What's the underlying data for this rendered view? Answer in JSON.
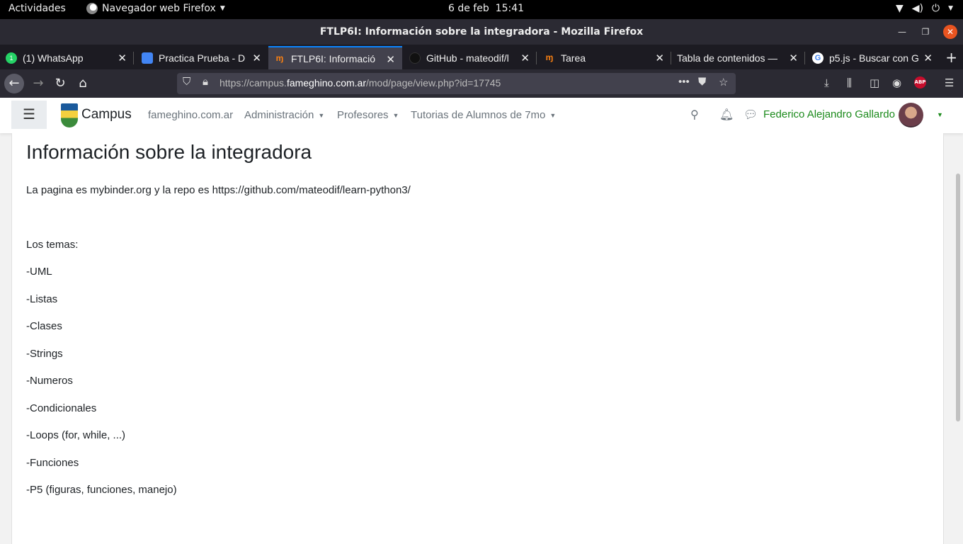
{
  "system": {
    "activities": "Actividades",
    "app_name": "Navegador web Firefox",
    "date": "6 de feb",
    "time": "15:41"
  },
  "window": {
    "title": "FTLP6I: Información sobre la integradora - Mozilla Firefox"
  },
  "tabs": [
    {
      "label": "(1) WhatsApp",
      "favicon": "whatsapp-icon",
      "badge": "1"
    },
    {
      "label": "Practica Prueba - D",
      "favicon": "docs-icon"
    },
    {
      "label": "FTLP6I: Informació",
      "favicon": "moodle-icon",
      "active": true
    },
    {
      "label": "GitHub - mateodif/l",
      "favicon": "github-icon"
    },
    {
      "label": "Tarea",
      "favicon": "moodle-icon"
    },
    {
      "label": "Tabla de contenidos —",
      "favicon": "none"
    },
    {
      "label": "p5.js - Buscar con G",
      "favicon": "google-icon"
    }
  ],
  "url": {
    "prefix": "https://campus.",
    "domain": "fameghino.com.ar",
    "path": "/mod/page/view.php?id=17745"
  },
  "moodle": {
    "brand": "Campus",
    "nav": [
      "fameghino.com.ar",
      "Administración",
      "Profesores",
      "Tutorias de Alumnos de 7mo"
    ],
    "user": "Federico Alejandro Gallardo"
  },
  "page": {
    "title": "Información sobre la integradora",
    "intro": "La pagina es mybinder.org y la repo es https://github.com/mateodif/learn-python3/",
    "topics_heading": "Los temas:",
    "topics": [
      "-UML",
      "-Listas",
      "-Clases",
      "-Strings",
      "-Numeros",
      "-Condicionales",
      "-Loops (for, while, ...)",
      "-Funciones",
      "-P5 (figuras, funciones, manejo)"
    ]
  },
  "colors": {
    "accent": "#0a84ff",
    "user_link": "#1b8a1b",
    "ubuntu_orange": "#e95420"
  }
}
